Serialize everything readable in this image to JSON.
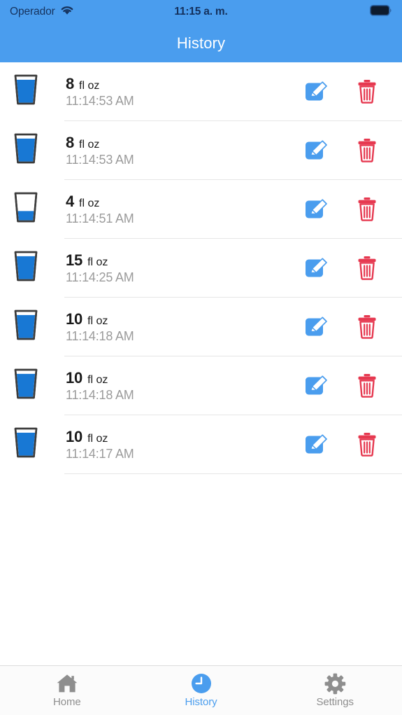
{
  "theme": {
    "accent": "#4a9dee",
    "header_bg": "#4a9dee",
    "header_text": "#ffffff",
    "status_text": "#16335e",
    "amount_text": "#1a1a1a",
    "time_text": "#9b9b9b",
    "divider": "#e6e6e6",
    "edit_icon": "#4a9dee",
    "delete_icon": "#e63950",
    "tab_inactive": "#8e8e8e",
    "tab_active": "#4a9dee",
    "glass_water": "#1878d4",
    "glass_outline": "#3c3c3c",
    "tabbar_bg": "#fbfbfb"
  },
  "statusbar": {
    "carrier": "Operador",
    "wifi_icon": "wifi-icon",
    "time": "11:15 a. m.",
    "battery_icon": "battery-full-icon"
  },
  "navbar": {
    "title": "History"
  },
  "list": {
    "unit": "fl oz",
    "edit_icon": "edit-pencil-icon",
    "delete_icon": "trash-icon",
    "glass_icon": "water-glass-icon",
    "rows": [
      {
        "amount": "8",
        "unit": "fl oz",
        "time": "11:14:53 AM",
        "fill_percent": 92
      },
      {
        "amount": "8",
        "unit": "fl oz",
        "time": "11:14:53 AM",
        "fill_percent": 92
      },
      {
        "amount": "4",
        "unit": "fl oz",
        "time": "11:14:51 AM",
        "fill_percent": 38
      },
      {
        "amount": "15",
        "unit": "fl oz",
        "time": "11:14:25 AM",
        "fill_percent": 92
      },
      {
        "amount": "10",
        "unit": "fl oz",
        "time": "11:14:18 AM",
        "fill_percent": 92
      },
      {
        "amount": "10",
        "unit": "fl oz",
        "time": "11:14:18 AM",
        "fill_percent": 92
      },
      {
        "amount": "10",
        "unit": "fl oz",
        "time": "11:14:17 AM",
        "fill_percent": 92
      }
    ]
  },
  "tabbar": {
    "tabs": [
      {
        "label": "Home",
        "icon": "home-icon",
        "active": false
      },
      {
        "label": "History",
        "icon": "clock-icon",
        "active": true
      },
      {
        "label": "Settings",
        "icon": "gear-icon",
        "active": false
      }
    ]
  }
}
